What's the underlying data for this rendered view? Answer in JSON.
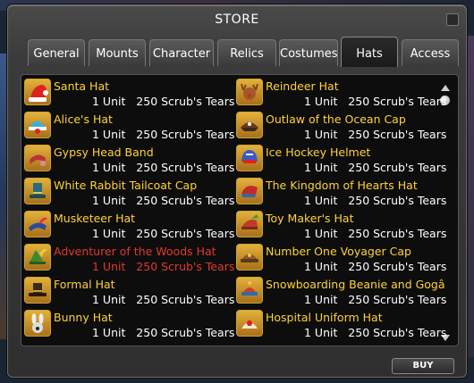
{
  "window": {
    "title": "STORE"
  },
  "tabs": [
    {
      "label": "General",
      "active": false
    },
    {
      "label": "Mounts",
      "active": false
    },
    {
      "label": "Character",
      "active": false
    },
    {
      "label": "Relics",
      "active": false
    },
    {
      "label": "Costumes",
      "active": false
    },
    {
      "label": "Hats",
      "active": true
    },
    {
      "label": "Access",
      "active": false
    }
  ],
  "items_left": [
    {
      "name": "Santa Hat",
      "detail": "1 Unit   250 Scrub's Tears",
      "icon": "santa-hat-icon",
      "unaffordable": false
    },
    {
      "name": "Alice's Hat",
      "detail": "1 Unit   250 Scrub's Tears",
      "icon": "alice-hat-icon",
      "unaffordable": false
    },
    {
      "name": "Gypsy Head Band",
      "detail": "1 Unit   250 Scrub's Tears",
      "icon": "head-band-icon",
      "unaffordable": false
    },
    {
      "name": "White Rabbit Tailcoat Cap",
      "detail": "1 Unit   250 Scrub's Tears",
      "icon": "top-hat-icon",
      "unaffordable": false
    },
    {
      "name": "Musketeer Hat",
      "detail": "1 Unit   250 Scrub's Tears",
      "icon": "musketeer-hat-icon",
      "unaffordable": false
    },
    {
      "name": "Adventurer of the Woods Hat",
      "detail": "1 Unit   250 Scrub's Tears",
      "icon": "woods-hat-icon",
      "unaffordable": true
    },
    {
      "name": "Formal Hat",
      "detail": "1 Unit   250 Scrub's Tears",
      "icon": "formal-hat-icon",
      "unaffordable": false
    },
    {
      "name": "Bunny Hat",
      "detail": "1 Unit   250 Scrub's Tears",
      "icon": "bunny-hat-icon",
      "unaffordable": false
    }
  ],
  "items_right": [
    {
      "name": "Reindeer Hat",
      "detail": "1 Unit   250 Scrub's Tears",
      "icon": "reindeer-hat-icon",
      "unaffordable": false
    },
    {
      "name": "Outlaw of the Ocean Cap",
      "detail": "1 Unit   250 Scrub's Tears",
      "icon": "outlaw-cap-icon",
      "unaffordable": false
    },
    {
      "name": "Ice Hockey Helmet",
      "detail": "1 Unit   250 Scrub's Tears",
      "icon": "hockey-helmet-icon",
      "unaffordable": false
    },
    {
      "name": "The Kingdom of Hearts Hat",
      "detail": "1 Unit   250 Scrub's Tears",
      "icon": "hearts-hat-icon",
      "unaffordable": false
    },
    {
      "name": "Toy Maker's Hat",
      "detail": "1 Unit   250 Scrub's Tears",
      "icon": "toy-maker-hat-icon",
      "unaffordable": false
    },
    {
      "name": "Number One Voyager Cap",
      "detail": "1 Unit   250 Scrub's Tears",
      "icon": "voyager-cap-icon",
      "unaffordable": false
    },
    {
      "name": "Snowboarding Beanie and Gogâ",
      "detail": "1 Unit   250 Scrub's Tears",
      "icon": "beanie-icon",
      "unaffordable": false
    },
    {
      "name": "Hospital Uniform Hat",
      "detail": "1 Unit   250 Scrub's Tears",
      "icon": "nurse-hat-icon",
      "unaffordable": false
    }
  ],
  "buy_button": {
    "label": "BUY"
  },
  "colors": {
    "item_name": "#ffd23a",
    "unaffordable": "#e2382e",
    "detail": "#ffffff"
  }
}
